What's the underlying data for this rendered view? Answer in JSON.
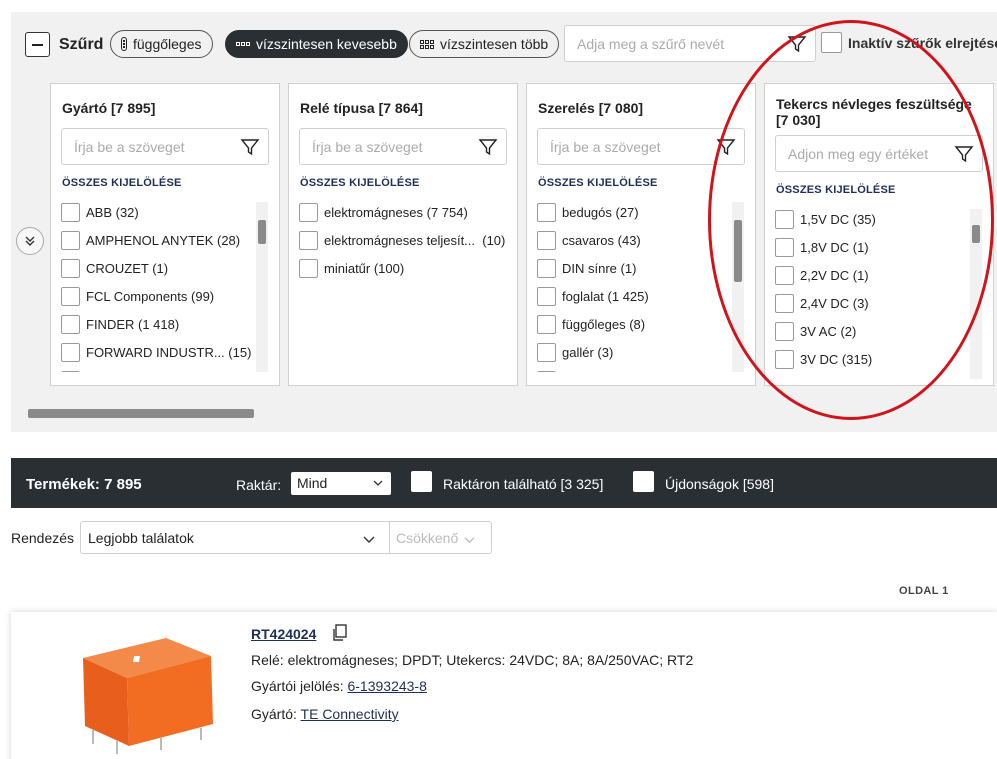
{
  "filter_header": {
    "title": "Szűrd",
    "view_buttons": [
      {
        "label": "függőleges",
        "active": false
      },
      {
        "label": "vízszintesen kevesebb",
        "active": true
      },
      {
        "label": "vízszintesen több",
        "active": false
      }
    ],
    "filter_name_placeholder": "Adja meg a szűrő nevét",
    "inactive_label": "Inaktív szűrők elrejtése"
  },
  "facets": [
    {
      "title": "Gyártó [7 895]",
      "search_placeholder": "Írja be a szöveget",
      "select_all": "ÖSSZES KIJELÖLÉSE",
      "items": [
        "ABB (32)",
        "AMPHENOL ANYTEK (28)",
        "CROUZET (1)",
        "FCL Components (99)",
        "FINDER (1 418)",
        "FORWARD INDUSTR... (15)"
      ]
    },
    {
      "title": "Relé típusa [7 864]",
      "search_placeholder": "Írja be a szöveget",
      "select_all": "ÖSSZES KIJELÖLÉSE",
      "items": [
        "elektromágneses (7 754)",
        "elektromágneses teljesít...  (10)",
        "miniatűr (100)"
      ]
    },
    {
      "title": "Szerelés [7 080]",
      "search_placeholder": "Írja be a szöveget",
      "select_all": "ÖSSZES KIJELÖLÉSE",
      "items": [
        "bedugós (27)",
        "csavaros (43)",
        "DIN sínre (1)",
        "foglalat (1 425)",
        "függőleges (8)",
        "gallér (3)"
      ]
    },
    {
      "title_line1": "Tekercs névleges feszültsége",
      "title_line2": "[7 030]",
      "search_placeholder": "Adjon meg egy értéket",
      "select_all": "ÖSSZES KIJELÖLÉSE",
      "items": [
        "1,5V DC (35)",
        "1,8V DC (1)",
        "2,2V DC (1)",
        "2,4V DC (3)",
        "3V AC (2)",
        "3V DC (315)"
      ]
    }
  ],
  "product_bar": {
    "count": "Termékek: 7 895",
    "stock_label": "Raktár:",
    "stock_value": "Mind",
    "in_stock": "Raktáron található [3 325]",
    "new_items": "Újdonságok [598]"
  },
  "sort": {
    "label": "Rendezés",
    "value": "Legjobb találatok",
    "direction": "Csökkenő"
  },
  "page": {
    "label": "OLDAL 1"
  },
  "product": {
    "code": "RT424024",
    "description": "Relé: elektromágneses; DPDT; Utekercs: 24VDC; 8A; 8A/250VAC; RT2",
    "mfr_part_label": "Gyártói jelölés: ",
    "mfr_part": "6-1393243-8",
    "manufacturer_label": "Gyártó: ",
    "manufacturer": "TE Connectivity"
  },
  "colors": {
    "accent": "#1e2f55",
    "dark_bar": "#2a2f33",
    "annotation": "#d0141c",
    "relay": "#f26d21"
  }
}
